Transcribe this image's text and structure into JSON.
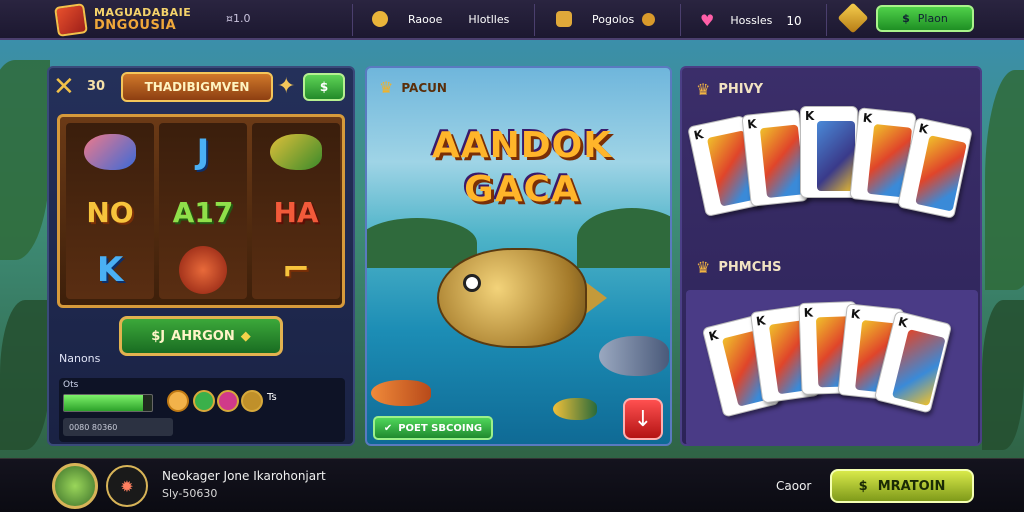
{
  "topbar": {
    "logo_line1": "MAGUADABAIE",
    "logo_line2": "DNGOUSIA",
    "small_text": "¤1.0",
    "item1_a": "Raooe",
    "item1_b": "Hlotlles",
    "item2": "Pogolos",
    "item3_label": "Hossles",
    "item3_value": "10",
    "button_label": "Plaon"
  },
  "slot": {
    "counter": "30",
    "title": "THADIBIGMVEN",
    "dollar": "$",
    "symbols": [
      "",
      "J",
      "",
      "NO",
      "A17",
      "HA",
      "K",
      "",
      ""
    ],
    "spin_label": "AHRGON",
    "spin_prefix": "$J",
    "names_label": "Nanons",
    "bonus_label": "Ots",
    "coin_suffix": "Ts",
    "progress": 0.9,
    "bonus_sub": "0080 80360"
  },
  "fishing": {
    "header": "PACUN",
    "title_line1": "AANDOK",
    "title_line2": "GACA",
    "action_label": "POET SBCOING",
    "down_icon": "↓"
  },
  "cards": {
    "header1": "PHIVY",
    "header2": "PHMCHS",
    "rank": "K"
  },
  "bottom": {
    "player_name": "Neokager Jone Ikarohonjart",
    "player_sub": "Sly-50630",
    "label": "Caoor",
    "button_label": "MRATOIN",
    "button_prefix": "$"
  }
}
